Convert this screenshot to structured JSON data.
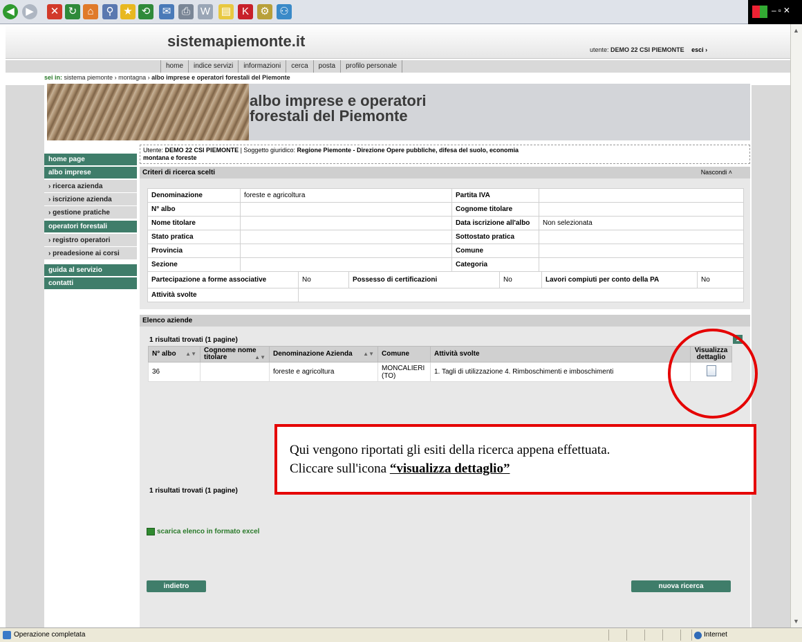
{
  "browser": {
    "status": "Operazione completata",
    "zone": "Internet"
  },
  "site": {
    "brand": "sistemapiemonte.it",
    "user_label": "utente:",
    "user_name": "DEMO 22 CSI PIEMONTE",
    "logout": "esci",
    "nav": [
      "home",
      "indice servizi",
      "informazioni",
      "cerca",
      "posta",
      "profilo personale"
    ],
    "breadcrumb_label": "sei in:",
    "breadcrumb": [
      "sistema piemonte",
      "montagna",
      "albo imprese e operatori forestali del Piemonte"
    ]
  },
  "banner": {
    "line1": "albo imprese e operatori",
    "line2": "forestali del Piemonte"
  },
  "sidebar": [
    {
      "label": "home page",
      "type": "group"
    },
    {
      "label": "albo imprese",
      "type": "group"
    },
    {
      "label": "ricerca azienda",
      "type": "sub"
    },
    {
      "label": "iscrizione azienda",
      "type": "sub"
    },
    {
      "label": "gestione pratiche",
      "type": "sub"
    },
    {
      "label": "operatori forestali",
      "type": "group"
    },
    {
      "label": "registro operatori",
      "type": "sub"
    },
    {
      "label": "preadesione ai corsi",
      "type": "sub"
    },
    {
      "label": "guida al servizio",
      "type": "group"
    },
    {
      "label": "contatti",
      "type": "group"
    }
  ],
  "userinfo": {
    "label_user": "Utente:",
    "user": "DEMO 22 CSI PIEMONTE",
    "label_subject": "Soggetto giuridico:",
    "subject_line1": "Regione Piemonte - Direzione Opere pubbliche, difesa del suolo, economia",
    "subject_line2": "montana e foreste"
  },
  "criteria": {
    "title": "Criteri di ricerca scelti",
    "hide": "Nascondi",
    "rows": [
      [
        "Denominazione",
        "foreste e agricoltura",
        "Partita IVA",
        ""
      ],
      [
        "N° albo",
        "",
        "Cognome titolare",
        ""
      ],
      [
        "Nome titolare",
        "",
        "Data iscrizione all'albo",
        "Non selezionata"
      ],
      [
        "Stato pratica",
        "",
        "Sottostato pratica",
        ""
      ],
      [
        "Provincia",
        "",
        "Comune",
        ""
      ],
      [
        "Sezione",
        "",
        "Categoria",
        ""
      ]
    ],
    "row3": [
      "Partecipazione a forme associative",
      "No",
      "Possesso di certificazioni",
      "No",
      "Lavori compiuti per conto della PA",
      "No"
    ],
    "activities_label": "Attività svolte",
    "activities_value": ""
  },
  "results": {
    "title": "Elenco aziende",
    "count_top": "1 risultati trovati (1 pagine)",
    "count_bottom": "1 risultati trovati (1 pagine)",
    "page": "1",
    "headers": [
      "N° albo",
      "Cognome nome titolare",
      "Denominazione Azienda",
      "Comune",
      "Attività svolte",
      "Visualizza dettaglio"
    ],
    "rows": [
      [
        "36",
        "",
        "foreste e agricoltura",
        "MONCALIERI (TO)",
        "1. Tagli di utilizzazione 4. Rimboschimenti e imboschimenti"
      ]
    ],
    "excel": "scarica elenco in formato excel",
    "back": "indietro",
    "new_search": "nuova ricerca"
  },
  "callout": {
    "line1": "Qui vengono riportati gli esiti della ricerca appena effettuata.",
    "line2_prefix": "Cliccare sull'icona ",
    "line2_em": "“visualizza dettaglio”"
  },
  "colors": {
    "accent": "#3f7d6a",
    "callout": "#e50000"
  }
}
